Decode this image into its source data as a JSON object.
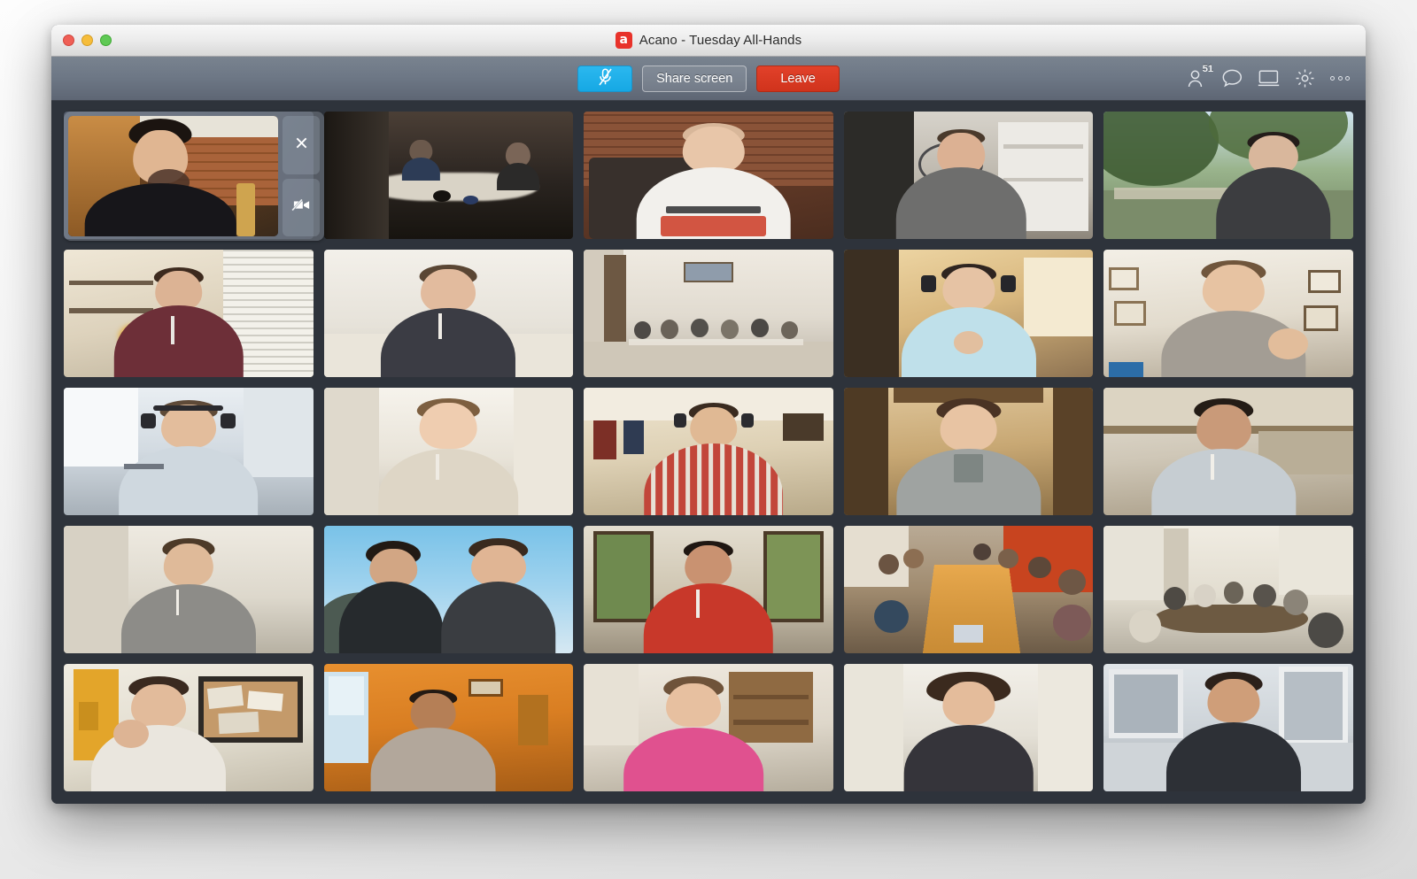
{
  "desktop": {
    "background_color": "#ededed"
  },
  "window": {
    "title": "Acano - Tuesday All-Hands",
    "app_logo_glyph": "a",
    "app_logo_color": "#e8322a",
    "background_color": "#2e333b",
    "traffic_lights": [
      {
        "name": "close",
        "color": "#ef5f56"
      },
      {
        "name": "minimize",
        "color": "#f6bd3b"
      },
      {
        "name": "zoom",
        "color": "#5fc955"
      }
    ]
  },
  "toolbar": {
    "mic_button": {
      "label": "",
      "icon": "microphone-muted-icon",
      "state": "muted",
      "color": "#16a8e4"
    },
    "share_label": "Share screen",
    "leave_label": "Leave",
    "leave_color": "#d0331c",
    "right_icons": [
      {
        "name": "participants-icon",
        "badge": "51"
      },
      {
        "name": "chat-bubble-icon",
        "badge": ""
      },
      {
        "name": "screen-share-icon",
        "badge": ""
      },
      {
        "name": "settings-gear-icon",
        "badge": ""
      },
      {
        "name": "more-options-icon",
        "badge": ""
      }
    ]
  },
  "self_view": {
    "label": "self-view",
    "close_glyph": "×",
    "camera_button_icon": "camera-off-icon"
  },
  "grid": {
    "columns": 5,
    "rows": 5,
    "participant_count": "51",
    "tiles": [
      {
        "id": 1,
        "scene": "self-view-placeholder",
        "description": "Self view: man with glasses and beard, brick wall"
      },
      {
        "id": 2,
        "scene": "meeting-room-dark",
        "description": "Two men at a white conference table, dark room"
      },
      {
        "id": 3,
        "scene": "brick-tshirt",
        "description": "Man with glasses, white t-shirt reading I'M CALLING IT SHEA, brick wall"
      },
      {
        "id": 4,
        "scene": "kitchen-bike",
        "description": "Man in gray tee, kitchen with bicycle and white shelving"
      },
      {
        "id": 5,
        "scene": "outdoor-trees",
        "description": "Woman with glasses outdoors, trees and picnic table"
      },
      {
        "id": 6,
        "scene": "shelves-blinds",
        "description": "Man in maroon shirt with earbuds, shelves and window blinds"
      },
      {
        "id": 7,
        "scene": "white-wall-woman",
        "description": "Woman with glasses and earbuds, plain white wall"
      },
      {
        "id": 8,
        "scene": "boardroom-wide",
        "description": "Wide board room, several people seated with laptops"
      },
      {
        "id": 9,
        "scene": "headset-man-warm",
        "description": "Man with headset and glasses, hands together, warm room"
      },
      {
        "id": 10,
        "scene": "gallery-wall-man",
        "description": "Man with glasses resting head on hand, framed pictures wall"
      },
      {
        "id": 11,
        "scene": "headset-man-window",
        "description": "Man with headset in blue shirt, bright window behind"
      },
      {
        "id": 12,
        "scene": "woman-glasses-bright",
        "description": "Woman with glasses in light top, bright room"
      },
      {
        "id": 13,
        "scene": "home-coats-headset",
        "description": "Man in red plaid shirt with headset, coats on hooks"
      },
      {
        "id": 14,
        "scene": "wood-cabin-woman",
        "description": "Woman with dark glasses and lanyard, wooden cabin interior"
      },
      {
        "id": 15,
        "scene": "porch-woman",
        "description": "Person in gray hoodie with earbuds, wooden porch"
      },
      {
        "id": 16,
        "scene": "man-glasses-plain",
        "description": "Man with glasses and earbuds, plain wall"
      },
      {
        "id": 17,
        "scene": "two-people-sky",
        "description": "Two people outdoors against blue sky"
      },
      {
        "id": 18,
        "scene": "red-shirt-windows",
        "description": "Man in red shirt with earbuds, tall windows and trees"
      },
      {
        "id": 19,
        "scene": "long-table-crowd",
        "description": "Crowded long table meeting, orange wall"
      },
      {
        "id": 20,
        "scene": "conference-room-group",
        "description": "Conference room with group seated around table"
      },
      {
        "id": 21,
        "scene": "corkboard-woman",
        "description": "Woman touching forehead, corkboard on wall"
      },
      {
        "id": 22,
        "scene": "orange-room-man",
        "description": "Man in gray tee, orange walls with picture"
      },
      {
        "id": 23,
        "scene": "pink-shirt-woman",
        "description": "Woman with glasses in pink top, shelves behind"
      },
      {
        "id": 24,
        "scene": "curly-hair-woman",
        "description": "Woman with curly hair in dark top, light wall"
      },
      {
        "id": 25,
        "scene": "window-light-man",
        "description": "Man in dark shirt near bright window frames"
      }
    ]
  }
}
